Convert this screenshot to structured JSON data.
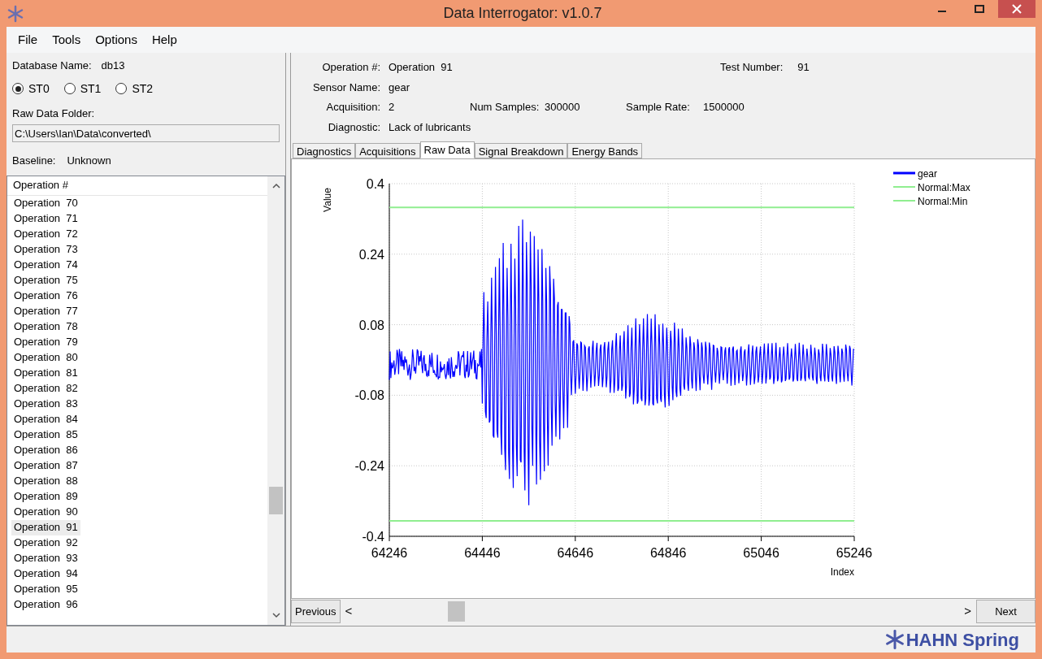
{
  "window": {
    "title": "Data Interrogator: v1.0.7"
  },
  "menu": [
    "File",
    "Tools",
    "Options",
    "Help"
  ],
  "left": {
    "database_label": "Database Name:",
    "database_value": "db13",
    "stations": [
      {
        "label": "ST0",
        "selected": true
      },
      {
        "label": "ST1",
        "selected": false
      },
      {
        "label": "ST2",
        "selected": false
      }
    ],
    "folder_label": "Raw Data Folder:",
    "folder_value": "C:\\Users\\Ian\\Data\\converted\\",
    "baseline_label": "Baseline:",
    "baseline_value": "Unknown",
    "list_header": "Operation #",
    "operations": [
      {
        "label": "Operation  70",
        "selected": false
      },
      {
        "label": "Operation  71",
        "selected": false
      },
      {
        "label": "Operation  72",
        "selected": false
      },
      {
        "label": "Operation  73",
        "selected": false
      },
      {
        "label": "Operation  74",
        "selected": false
      },
      {
        "label": "Operation  75",
        "selected": false
      },
      {
        "label": "Operation  76",
        "selected": false
      },
      {
        "label": "Operation  77",
        "selected": false
      },
      {
        "label": "Operation  78",
        "selected": false
      },
      {
        "label": "Operation  79",
        "selected": false
      },
      {
        "label": "Operation  80",
        "selected": false
      },
      {
        "label": "Operation  81",
        "selected": false
      },
      {
        "label": "Operation  82",
        "selected": false
      },
      {
        "label": "Operation  83",
        "selected": false
      },
      {
        "label": "Operation  84",
        "selected": false
      },
      {
        "label": "Operation  85",
        "selected": false
      },
      {
        "label": "Operation  86",
        "selected": false
      },
      {
        "label": "Operation  87",
        "selected": false
      },
      {
        "label": "Operation  88",
        "selected": false
      },
      {
        "label": "Operation  89",
        "selected": false
      },
      {
        "label": "Operation  90",
        "selected": false
      },
      {
        "label": "Operation  91",
        "selected": true
      },
      {
        "label": "Operation  92",
        "selected": false
      },
      {
        "label": "Operation  93",
        "selected": false
      },
      {
        "label": "Operation  94",
        "selected": false
      },
      {
        "label": "Operation  95",
        "selected": false
      },
      {
        "label": "Operation  96",
        "selected": false
      }
    ]
  },
  "info": {
    "operation_label": "Operation #:",
    "operation_value": "Operation  91",
    "test_label": "Test Number:",
    "test_value": "91",
    "sensor_label": "Sensor Name:",
    "sensor_value": "gear",
    "acquisition_label": "Acquisition:",
    "acquisition_value": "2",
    "samples_label": "Num Samples:",
    "samples_value": "300000",
    "rate_label": "Sample Rate:",
    "rate_value": "1500000",
    "diagnostic_label": "Diagnostic:",
    "diagnostic_value": "Lack of lubricants"
  },
  "tabs": [
    {
      "label": "Diagnostics",
      "selected": false
    },
    {
      "label": "Acquisitions",
      "selected": false
    },
    {
      "label": "Raw Data",
      "selected": true
    },
    {
      "label": "Signal Breakdown",
      "selected": false
    },
    {
      "label": "Energy Bands",
      "selected": false
    }
  ],
  "chart": {
    "chart_data": {
      "type": "line",
      "xlabel": "Index",
      "ylabel": "Value",
      "xlim": [
        64246,
        65246
      ],
      "ylim": [
        -0.4,
        0.4
      ],
      "xticks": [
        64246,
        64446,
        64646,
        64846,
        65046,
        65246
      ],
      "yticks": [
        {
          "value": 0.4,
          "label": "0.4"
        },
        {
          "value": 0.24,
          "label": "0.24"
        },
        {
          "value": 0.08,
          "label": "0.08"
        },
        {
          "value": -0.08,
          "label": "-0.08"
        },
        {
          "value": -0.24,
          "label": "-0.24"
        },
        {
          "value": -0.4,
          "label": "-0.4"
        }
      ],
      "x": [
        64246,
        65246
      ],
      "grid": true,
      "legend": true,
      "series": [
        {
          "name": "Normal:Max",
          "color": "#90ee90",
          "values": [
            0.346,
            0.346
          ]
        },
        {
          "name": "Normal:Min",
          "color": "#90ee90",
          "values": [
            -0.365,
            -0.365
          ]
        }
      ]
    },
    "signal": {
      "name": "gear",
      "color": "#0000ff"
    }
  },
  "nav": {
    "previous": "Previous",
    "next": "Next",
    "prev_arrow": "<",
    "next_arrow": ">"
  },
  "status": {
    "logo_text": "HAHN Spring"
  }
}
